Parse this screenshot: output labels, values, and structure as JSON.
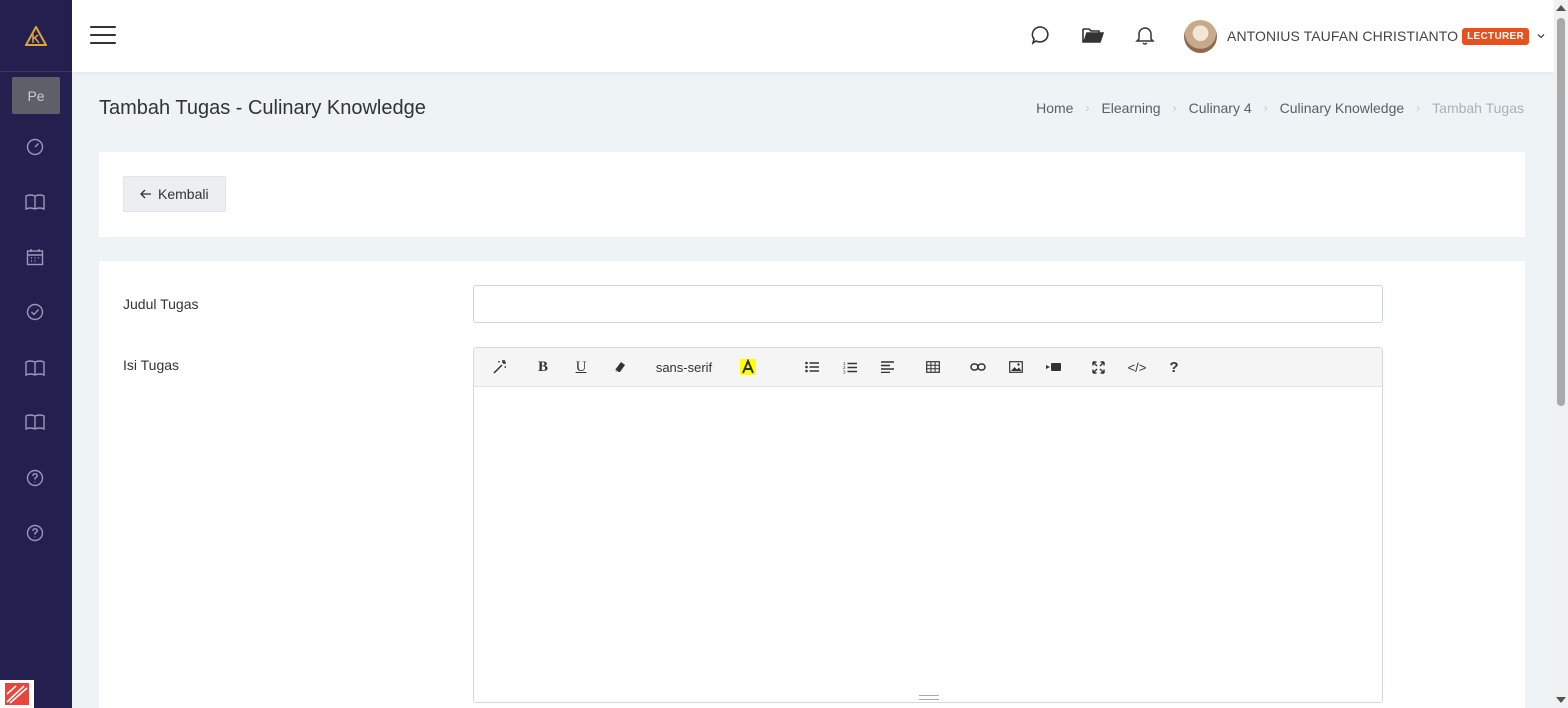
{
  "sidebar": {
    "collapsed_label": "Pe",
    "icons": [
      "dashboard-icon",
      "book-icon",
      "calendar-icon",
      "check-circle-icon",
      "book-icon",
      "book-icon",
      "help-icon",
      "help-icon"
    ]
  },
  "topbar": {
    "icons": [
      "chat-icon",
      "folder-icon",
      "bell-icon"
    ],
    "user_name": "ANTONIUS TAUFAN CHRISTIANTO",
    "role": "LECTURER"
  },
  "header": {
    "title": "Tambah Tugas - Culinary Knowledge",
    "breadcrumb": [
      "Home",
      "Elearning",
      "Culinary 4",
      "Culinary Knowledge",
      "Tambah Tugas"
    ]
  },
  "actions": {
    "back_label": "Kembali"
  },
  "form": {
    "title_label": "Judul Tugas",
    "title_value": "",
    "content_label": "Isi Tugas",
    "font_name": "sans-serif",
    "toolbar": [
      "magic-icon",
      "bold-icon",
      "underline-icon",
      "eraser-icon",
      "font-name",
      "highlight-icon",
      "bullet-list-icon",
      "numbered-list-icon",
      "align-icon",
      "table-icon",
      "link-icon",
      "image-icon",
      "video-icon",
      "fullscreen-icon",
      "code-view-icon",
      "help-icon"
    ]
  },
  "colors": {
    "sidebar_bg": "#23204f",
    "role_badge": "#e8501e",
    "page_bg": "#eef3f6"
  }
}
